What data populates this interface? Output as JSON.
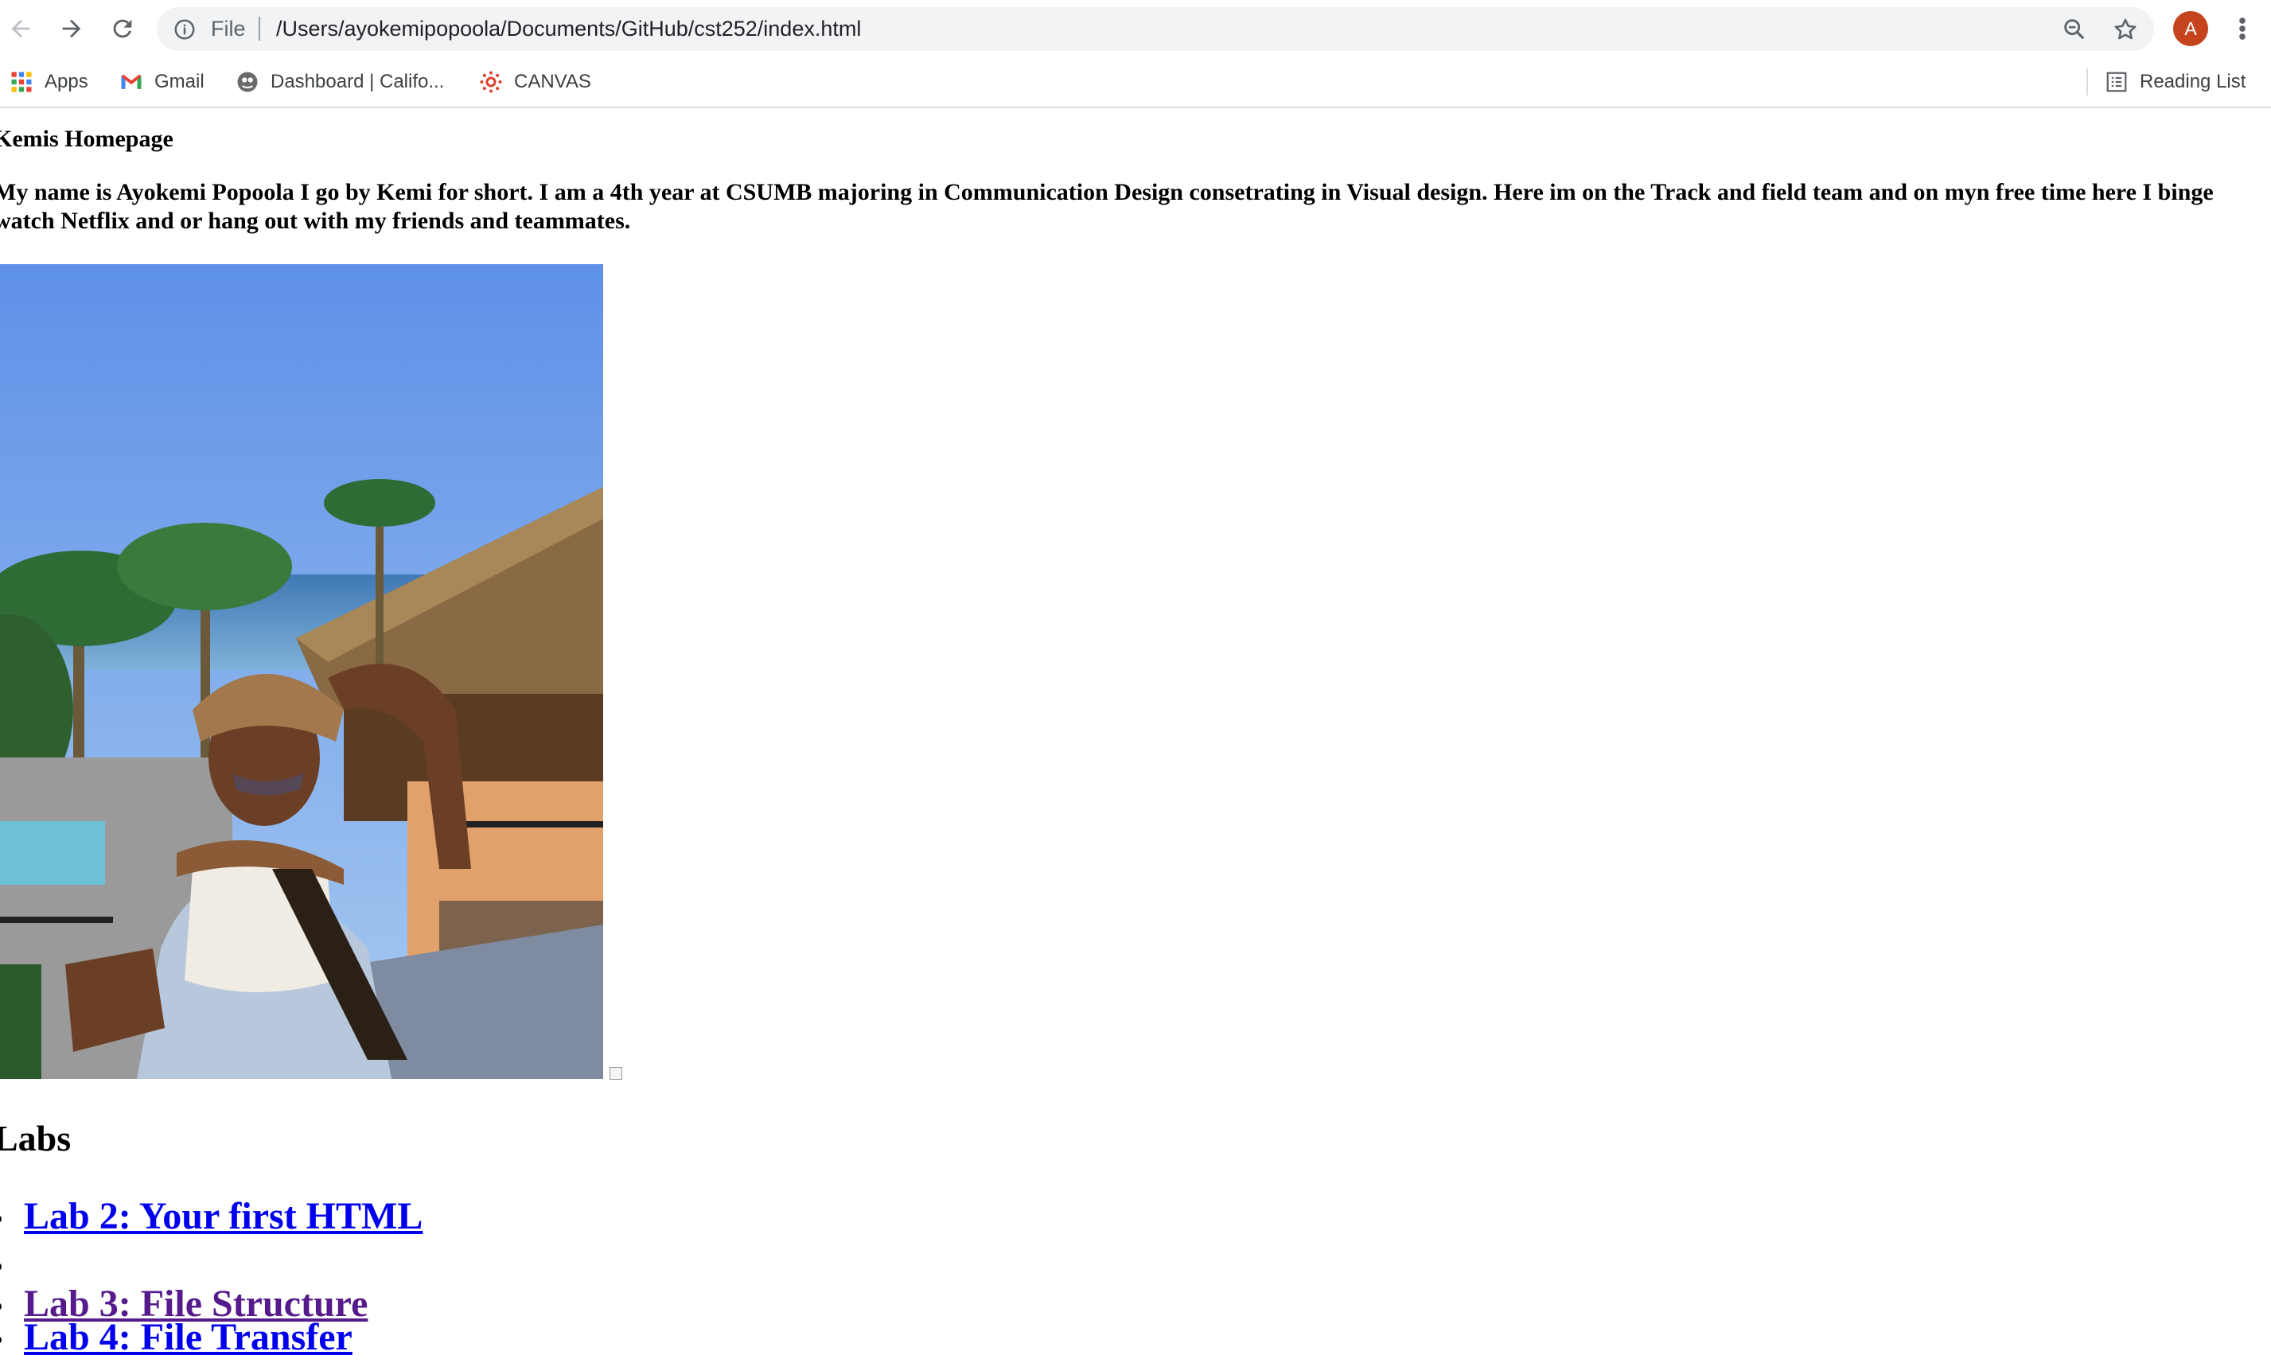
{
  "browser": {
    "omnibox": {
      "scheme_label": "File",
      "url": "/Users/ayokemipopoola/Documents/GitHub/cst252/index.html"
    },
    "profile_initial": "A",
    "bookmarks": [
      {
        "label": "Apps",
        "icon": "apps-grid-icon"
      },
      {
        "label": "Gmail",
        "icon": "gmail-icon"
      },
      {
        "label": "Dashboard | Califo...",
        "icon": "dashboard-favicon"
      },
      {
        "label": "CANVAS",
        "icon": "canvas-icon"
      }
    ],
    "reading_list_label": "Reading List"
  },
  "page": {
    "title": "Kemis Homepage",
    "intro": "My name is Ayokemi Popoola I go by Kemi for short. I am a 4th year at CSUMB majoring in Communication Design consetrating in Visual design. Here im on the Track and field team and on myn free time here I binge watch Netflix and or hang out with my friends and teammates.",
    "labs_heading": "Labs",
    "labs": [
      {
        "label": "Lab 2: Your first HTML",
        "visited": false
      },
      {
        "label": "",
        "visited": false
      },
      {
        "label": "Lab 3: File Structure",
        "visited": true
      },
      {
        "label": "Lab 4: File Transfer",
        "visited": false
      }
    ]
  },
  "colors": {
    "link": "#0000ee",
    "visited_link": "#551a8b",
    "avatar": "#c5441e",
    "omnibox_bg": "#f1f3f4"
  }
}
